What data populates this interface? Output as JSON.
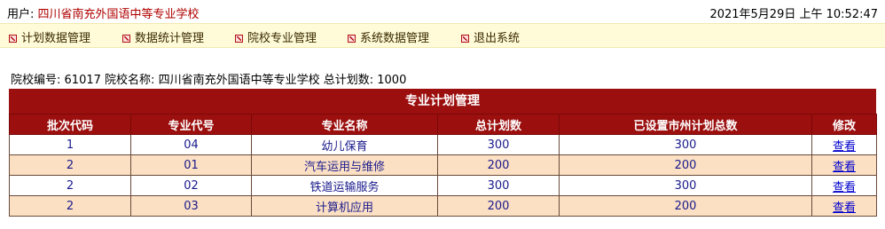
{
  "header": {
    "user_label": "用户:",
    "school_name": "四川省南充外国语中等专业学校",
    "datetime": "2021年5月29日 上午 10:52:47"
  },
  "menu": [
    {
      "label": "计划数据管理",
      "icon": "menu-arrow-icon"
    },
    {
      "label": "数据统计管理",
      "icon": "menu-arrow-icon"
    },
    {
      "label": "院校专业管理",
      "icon": "menu-arrow-icon"
    },
    {
      "label": "系统数据管理",
      "icon": "menu-arrow-icon"
    },
    {
      "label": "退出系统",
      "icon": "menu-arrow-icon"
    }
  ],
  "info": {
    "school_code_label": "院校编号:",
    "school_code": "61017",
    "school_name_label": "院校名称:",
    "school_name": "四川省南充外国语中等专业学校",
    "total_plan_label": "总计划数:",
    "total_plan": "1000"
  },
  "panel": {
    "title": "专业计划管理"
  },
  "table": {
    "headers": [
      "批次代码",
      "专业代号",
      "专业名称",
      "总计划数",
      "已设置市州计划总数",
      "修改"
    ],
    "rows": [
      {
        "batch": "1",
        "code": "04",
        "name": "幼儿保育",
        "total": "300",
        "assigned": "300",
        "action": "查看"
      },
      {
        "batch": "2",
        "code": "01",
        "name": "汽车运用与维修",
        "total": "200",
        "assigned": "200",
        "action": "查看"
      },
      {
        "batch": "2",
        "code": "02",
        "name": "铁道运输服务",
        "total": "300",
        "assigned": "300",
        "action": "查看"
      },
      {
        "batch": "2",
        "code": "03",
        "name": "计算机应用",
        "total": "200",
        "assigned": "200",
        "action": "查看"
      }
    ]
  },
  "colors": {
    "header_red": "#9c0f0f",
    "menu_bg": "#fffbd8",
    "row_alt": "#fbe0c4",
    "school_name_color": "#b00000"
  }
}
